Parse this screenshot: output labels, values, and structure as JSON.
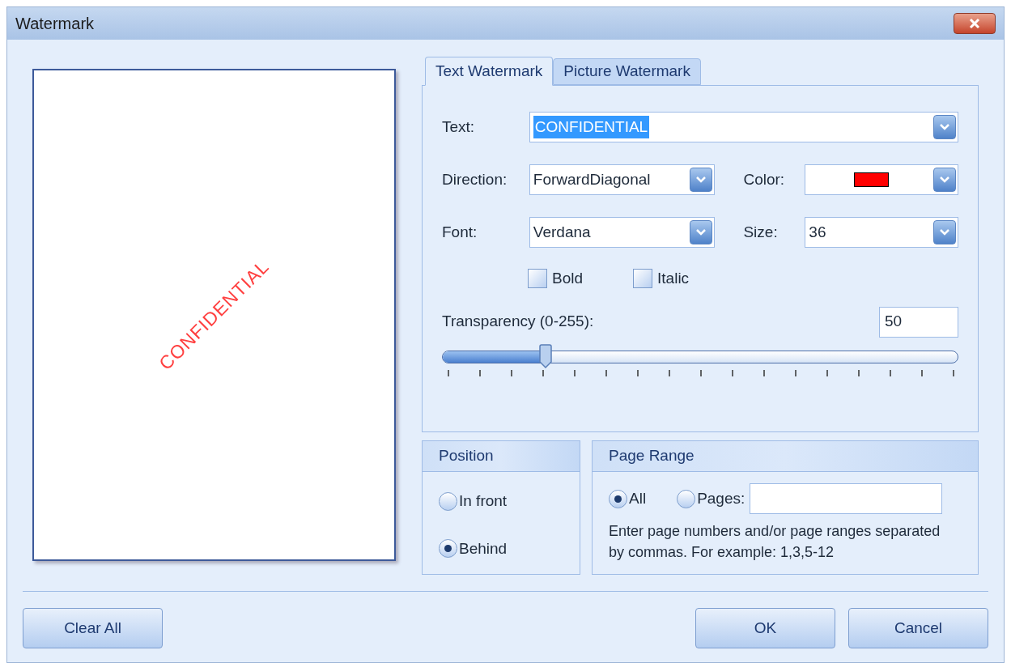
{
  "window": {
    "title": "Watermark"
  },
  "preview": {
    "text": "CONFIDENTIAL",
    "color": "#ff4040"
  },
  "tabs": [
    {
      "label": "Text Watermark",
      "selected": true
    },
    {
      "label": "Picture Watermark",
      "selected": false
    }
  ],
  "text_field": {
    "label": "Text:",
    "value": "CONFIDENTIAL",
    "highlighted": true
  },
  "direction": {
    "label": "Direction:",
    "value": "ForwardDiagonal"
  },
  "color": {
    "label": "Color:",
    "color": "#ff0000"
  },
  "font": {
    "label": "Font:",
    "value": "Verdana"
  },
  "size": {
    "label": "Size:",
    "value": "36"
  },
  "styles": [
    {
      "label": "Bold",
      "checked": false
    },
    {
      "label": "Italic",
      "checked": false
    }
  ],
  "transparency": {
    "label": "Transparency (0-255):",
    "value": "50",
    "level": 0.2
  },
  "position": {
    "title": "Position",
    "options": [
      {
        "label": "In front",
        "selected": false
      },
      {
        "label": "Behind",
        "selected": true
      }
    ]
  },
  "page_range": {
    "title": "Page Range",
    "options": [
      {
        "label": "All",
        "selected": true
      },
      {
        "label": "Pages:",
        "selected": false
      }
    ],
    "hint": "Enter page numbers and/or page ranges separated by commas. For example: 1,3,5-12"
  },
  "buttons": {
    "clear": "Clear All",
    "ok": "OK",
    "cancel": "Cancel"
  }
}
